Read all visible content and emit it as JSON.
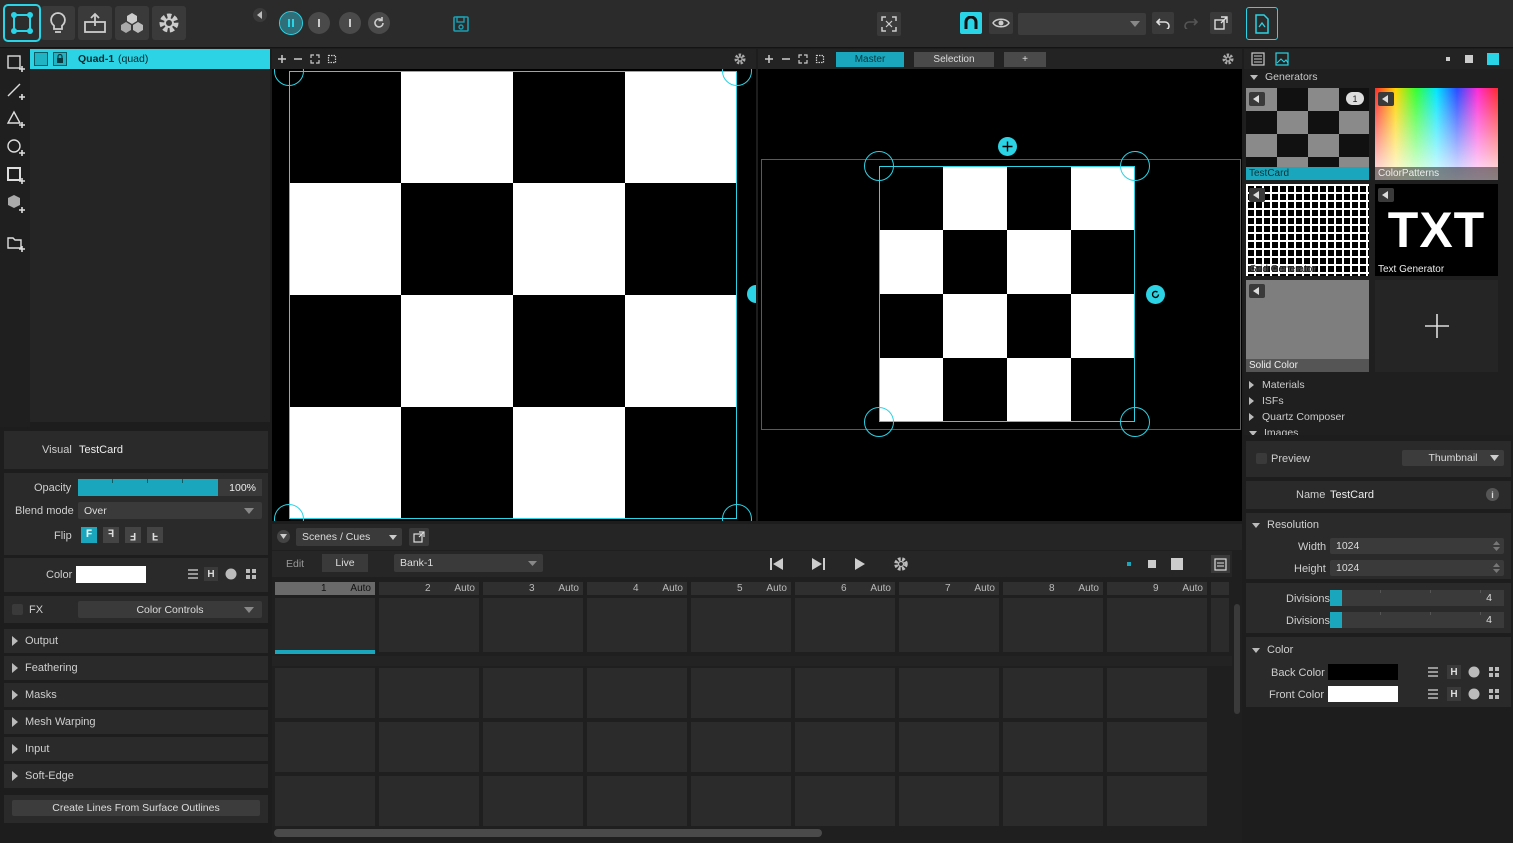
{
  "toolbar": {
    "preset_select_value": ""
  },
  "layers": {
    "items": [
      {
        "name": "Quad-1",
        "type": "(quad)"
      }
    ]
  },
  "properties": {
    "visual_label": "Visual",
    "visual_value": "TestCard",
    "opacity_label": "Opacity",
    "opacity_value": "100%",
    "opacity_fraction": 1.0,
    "blend_label": "Blend mode",
    "blend_value": "Over",
    "flip_label": "Flip",
    "color_label": "Color",
    "color_value": "#ffffff",
    "fx_label": "FX",
    "fx_value": "Color Controls",
    "sections": [
      "Output",
      "Feathering",
      "Masks",
      "Mesh Warping",
      "Input",
      "Soft-Edge"
    ],
    "create_lines_button": "Create Lines From Surface Outlines"
  },
  "output_tabs": {
    "master": "Master",
    "selection": "Selection",
    "add": "+"
  },
  "cues": {
    "scenes_dropdown": "Scenes / Cues",
    "edit_label": "Edit",
    "live_label": "Live",
    "bank_value": "Bank-1",
    "columns": [
      {
        "number": "1",
        "mode": "Auto"
      },
      {
        "number": "2",
        "mode": "Auto"
      },
      {
        "number": "3",
        "mode": "Auto"
      },
      {
        "number": "4",
        "mode": "Auto"
      },
      {
        "number": "5",
        "mode": "Auto"
      },
      {
        "number": "6",
        "mode": "Auto"
      },
      {
        "number": "7",
        "mode": "Auto"
      },
      {
        "number": "8",
        "mode": "Auto"
      },
      {
        "number": "9",
        "mode": "Auto"
      }
    ]
  },
  "library": {
    "generators_label": "Generators",
    "generators": [
      {
        "name": "TestCard",
        "badge": "1"
      },
      {
        "name": "ColorPatterns"
      },
      {
        "name": "Grid Generator"
      },
      {
        "name": "Text Generator",
        "preview_text": "TXT"
      },
      {
        "name": "Solid Color"
      }
    ],
    "folders": [
      "Materials",
      "ISFs",
      "Quartz Composer",
      "Images"
    ]
  },
  "inspector": {
    "preview_label": "Preview",
    "preview_mode": "Thumbnail",
    "name_label": "Name",
    "name_value": "TestCard",
    "resolution_label": "Resolution",
    "width_label": "Width",
    "width_value": "1024",
    "height_label": "Height",
    "height_value": "1024",
    "divisions_x_label": "Divisions X",
    "divisions_x_value": "4",
    "divisions_y_label": "Divisions Y",
    "divisions_y_value": "4",
    "color_section_label": "Color",
    "back_color_label": "Back Color",
    "back_color_value": "#000000",
    "front_color_label": "Front Color",
    "front_color_value": "#ffffff"
  },
  "colors": {
    "accent": "#29d4e6",
    "active_tab": "#1aa7bd"
  }
}
